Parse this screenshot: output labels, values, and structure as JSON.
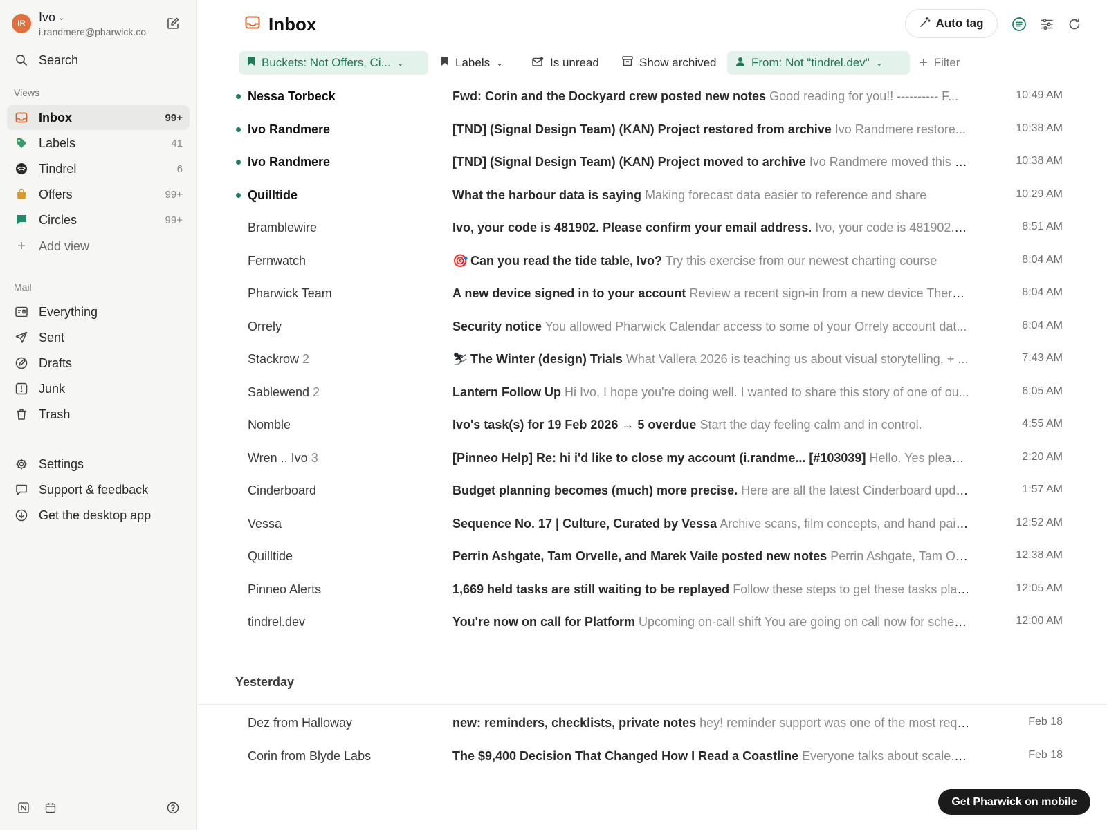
{
  "account": {
    "initials": "IR",
    "name": "Ivo",
    "email": "i.randmere@pharwick.co"
  },
  "sidebar": {
    "search_label": "Search",
    "views_heading": "Views",
    "views": [
      {
        "label": "Inbox",
        "count": "99+"
      },
      {
        "label": "Labels",
        "count": "41"
      },
      {
        "label": "Tindrel",
        "count": "6"
      },
      {
        "label": "Offers",
        "count": "99+"
      },
      {
        "label": "Circles",
        "count": "99+"
      }
    ],
    "add_view_label": "Add view",
    "mail_heading": "Mail",
    "mail": [
      {
        "label": "Everything"
      },
      {
        "label": "Sent"
      },
      {
        "label": "Drafts"
      },
      {
        "label": "Junk"
      },
      {
        "label": "Trash"
      }
    ],
    "bottom": [
      {
        "label": "Settings"
      },
      {
        "label": "Support & feedback"
      },
      {
        "label": "Get the desktop app"
      }
    ]
  },
  "header": {
    "title": "Inbox",
    "auto_tag_label": "Auto tag"
  },
  "filters": {
    "buckets": "Buckets: Not Offers, Ci...",
    "labels": "Labels",
    "is_unread": "Is unread",
    "show_archived": "Show archived",
    "from": "From: Not \"tindrel.dev\"",
    "add_filter": "Filter"
  },
  "today": [
    {
      "sender": "Nessa Torbeck",
      "thread": "",
      "unread": true,
      "emoji": "",
      "subject": "Fwd: Corin and the Dockyard crew posted new notes",
      "preview": "Good reading for you!! ---------- F...",
      "time": "10:49 AM"
    },
    {
      "sender": "Ivo Randmere",
      "thread": "",
      "unread": true,
      "emoji": "",
      "subject": "[TND] (Signal Design Team) (KAN) Project restored from archive",
      "preview": "Ivo Randmere restore...",
      "time": "10:38 AM"
    },
    {
      "sender": "Ivo Randmere",
      "thread": "",
      "unread": true,
      "emoji": "",
      "subject": "[TND] (Signal Design Team) (KAN) Project moved to archive",
      "preview": "Ivo Randmere moved this p...",
      "time": "10:38 AM"
    },
    {
      "sender": "Quilltide",
      "thread": "",
      "unread": true,
      "emoji": "",
      "subject": "What the harbour data is saying",
      "preview": "Making forecast data easier to reference and share",
      "time": "10:29 AM"
    },
    {
      "sender": "Bramblewire",
      "thread": "",
      "unread": false,
      "emoji": "",
      "subject": "Ivo, your code is 481902. Please confirm your email address.",
      "preview": "Ivo, your code is 481902. Pl...",
      "time": "8:51 AM"
    },
    {
      "sender": "Fernwatch",
      "thread": "",
      "unread": false,
      "emoji": "🎯",
      "subject": "Can you read the tide table, Ivo?",
      "preview": "Try this exercise from our newest charting course",
      "time": "8:04 AM"
    },
    {
      "sender": "Pharwick Team",
      "thread": "",
      "unread": false,
      "emoji": "",
      "subject": "A new device signed in to your account",
      "preview": "Review a recent sign-in from a new device There ...",
      "time": "8:04 AM"
    },
    {
      "sender": "Orrely",
      "thread": "",
      "unread": false,
      "emoji": "",
      "subject": "Security notice",
      "preview": "You allowed Pharwick Calendar access to some of your Orrely account dat...",
      "time": "8:04 AM"
    },
    {
      "sender": "Stackrow",
      "thread": "2",
      "unread": false,
      "emoji": "⛷",
      "subject": "The Winter (design) Trials",
      "preview": "What Vallera 2026 is teaching us about visual storytelling, + ...",
      "time": "7:43 AM"
    },
    {
      "sender": "Sablewend",
      "thread": "2",
      "unread": false,
      "emoji": "",
      "subject": "Lantern Follow Up",
      "preview": "Hi Ivo, I hope you're doing well. I wanted to share this story of one of ou...",
      "time": "6:05 AM"
    },
    {
      "sender": "Nomble",
      "thread": "",
      "unread": false,
      "emoji": "",
      "subject": "Ivo's task(s) for 19 Feb 2026 → 5 overdue",
      "preview": "Start the day feeling calm and in control.",
      "time": "4:55 AM"
    },
    {
      "sender": "Wren .. Ivo",
      "thread": "3",
      "unread": false,
      "emoji": "",
      "subject": "[Pinneo Help] Re: hi i'd like to close my account (i.randme... [#103039]",
      "preview": "Hello. Yes please ...",
      "time": "2:20 AM"
    },
    {
      "sender": "Cinderboard",
      "thread": "",
      "unread": false,
      "emoji": "",
      "subject": "Budget planning becomes (much) more precise.",
      "preview": "Here are all the latest Cinderboard updat...",
      "time": "1:57 AM"
    },
    {
      "sender": "Vessa",
      "thread": "",
      "unread": false,
      "emoji": "",
      "subject": "Sequence No. 17 | Culture, Curated by Vessa",
      "preview": "Archive scans, film concepts, and hand paint...",
      "time": "12:52 AM"
    },
    {
      "sender": "Quilltide",
      "thread": "",
      "unread": false,
      "emoji": "",
      "subject": "Perrin Ashgate, Tam Orvelle, and Marek Vaile posted new notes",
      "preview": "Perrin Ashgate, Tam Orve...",
      "time": "12:38 AM"
    },
    {
      "sender": "Pinneo Alerts",
      "thread": "",
      "unread": false,
      "emoji": "",
      "subject": "1,669 held tasks are still waiting to be replayed",
      "preview": "Follow these steps to get these tasks play...",
      "time": "12:05 AM"
    },
    {
      "sender": "tindrel.dev",
      "thread": "",
      "unread": false,
      "emoji": "",
      "subject": "You're now on call for Platform",
      "preview": "Upcoming on-call shift You are going on call now for sched...",
      "time": "12:00 AM"
    }
  ],
  "yesterday_heading": "Yesterday",
  "yesterday": [
    {
      "sender": "Dez from Halloway",
      "thread": "",
      "unread": false,
      "emoji": "",
      "subject": "new: reminders, checklists, private notes",
      "preview": "hey! reminder support was one of the most requ...",
      "time": "Feb 18"
    },
    {
      "sender": "Corin from Blyde Labs",
      "thread": "",
      "unread": false,
      "emoji": "",
      "subject": "The $9,400 Decision That Changed How I Read a Coastline",
      "preview": "Everyone talks about scale. B...",
      "time": "Feb 18"
    }
  ],
  "mobile_cta": "Get Pharwick on mobile",
  "colors": {
    "accent_green": "#1a7f5f",
    "avatar_orange": "#e0713f",
    "inbox_orange": "#d9622b",
    "labels_green": "#3f9a6b",
    "offers_amber": "#d79b2b",
    "circles_teal": "#1d8a6a"
  }
}
